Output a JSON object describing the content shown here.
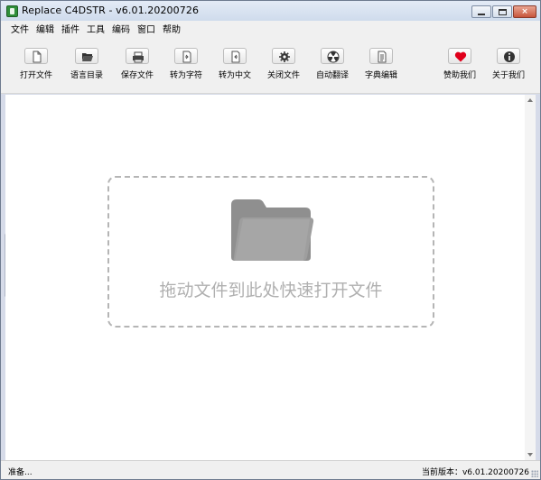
{
  "window": {
    "title": "Replace C4DSTR - v6.01.20200726",
    "controls": {
      "minimize": "min",
      "maximize": "max",
      "close": "×"
    }
  },
  "menu": {
    "items": [
      {
        "label": "文件"
      },
      {
        "label": "编辑"
      },
      {
        "label": "插件"
      },
      {
        "label": "工具"
      },
      {
        "label": "编码"
      },
      {
        "label": "窗口"
      },
      {
        "label": "帮助"
      }
    ]
  },
  "toolbar": {
    "buttons": [
      {
        "label": "打开文件",
        "icon": "blank-page-icon"
      },
      {
        "label": "语言目录",
        "icon": "folder-open-icon"
      },
      {
        "label": "保存文件",
        "icon": "printer-save-icon"
      },
      {
        "label": "转为字符",
        "icon": "convert-doc-icon"
      },
      {
        "label": "转为中文",
        "icon": "convert-doc-icon"
      },
      {
        "label": "关闭文件",
        "icon": "gear-icon"
      },
      {
        "label": "自动翻译",
        "icon": "radiation-icon"
      },
      {
        "label": "字典编辑",
        "icon": "text-doc-icon"
      },
      {
        "label": "赞助我们",
        "icon": "heart-icon"
      },
      {
        "label": "关于我们",
        "icon": "info-icon"
      }
    ]
  },
  "dropzone": {
    "text": "拖动文件到此处快速打开文件",
    "icon": "folder-icon"
  },
  "status": {
    "left": "准备...",
    "right": "当前版本：v6.01.20200726"
  },
  "colors": {
    "accent_heart": "#e0001b",
    "dropzone_text": "#b0b0b0",
    "folder_gray": "#8f8f8f"
  }
}
